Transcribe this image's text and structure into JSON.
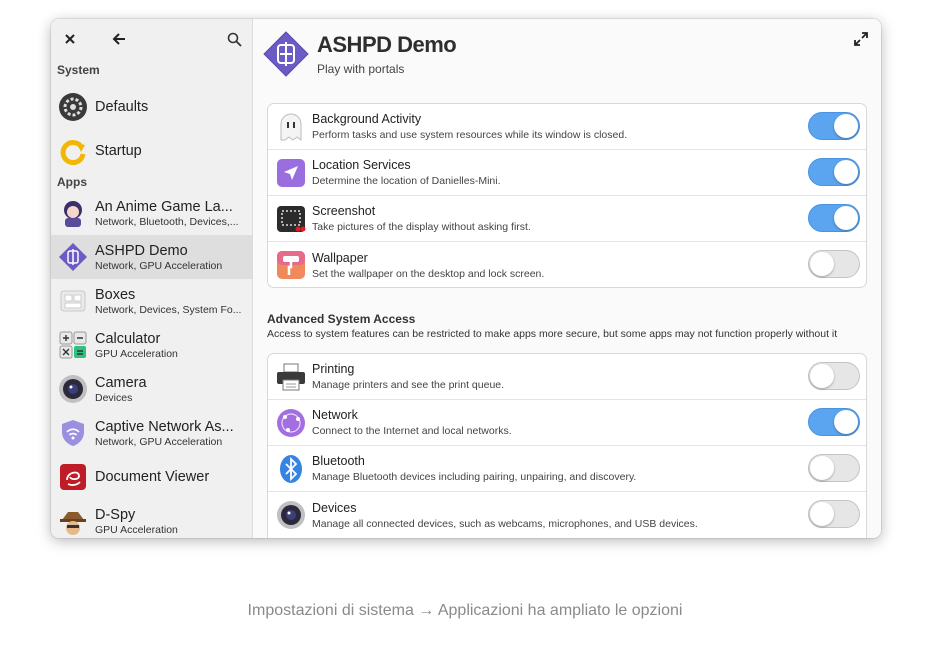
{
  "sidebar": {
    "section_system": "System",
    "system_items": [
      {
        "title": "Defaults",
        "icon": "settings-gear-icon"
      },
      {
        "title": "Startup",
        "icon": "startup-arrow-icon"
      }
    ],
    "section_apps": "Apps",
    "app_items": [
      {
        "title": "An Anime Game La...",
        "sub": "Network, Bluetooth, Devices,..."
      },
      {
        "title": "ASHPD Demo",
        "sub": "Network, GPU Acceleration"
      },
      {
        "title": "Boxes",
        "sub": "Network, Devices, System Fo..."
      },
      {
        "title": "Calculator",
        "sub": "GPU Acceleration"
      },
      {
        "title": "Camera",
        "sub": "Devices"
      },
      {
        "title": "Captive Network As...",
        "sub": "Network, GPU Acceleration"
      },
      {
        "title": "Document Viewer",
        "sub": ""
      },
      {
        "title": "D-Spy",
        "sub": "GPU Acceleration"
      }
    ]
  },
  "main": {
    "app_title": "ASHPD Demo",
    "app_subtitle": "Play with portals",
    "permissions": [
      {
        "title": "Background Activity",
        "sub": "Perform tasks and use system resources while its window is closed.",
        "enabled": true
      },
      {
        "title": "Location Services",
        "sub": "Determine the location of Danielles-Mini.",
        "enabled": true
      },
      {
        "title": "Screenshot",
        "sub": "Take pictures of the display without asking first.",
        "enabled": true
      },
      {
        "title": "Wallpaper",
        "sub": "Set the wallpaper on the desktop and lock screen.",
        "enabled": false
      }
    ],
    "advanced_title": "Advanced System Access",
    "advanced_desc": "Access to system features can be restricted to make apps more secure, but some apps may not function properly without it",
    "advanced": [
      {
        "title": "Printing",
        "sub": "Manage printers and see the print queue.",
        "enabled": false
      },
      {
        "title": "Network",
        "sub": "Connect to the Internet and local networks.",
        "enabled": true
      },
      {
        "title": "Bluetooth",
        "sub": "Manage Bluetooth devices including pairing, unpairing, and discovery.",
        "enabled": false
      },
      {
        "title": "Devices",
        "sub": "Manage all connected devices, such as webcams, microphones, and USB devices.",
        "enabled": false
      }
    ]
  },
  "caption": "Impostazioni di sistema → Applicazioni ha ampliato le opzioni",
  "colors": {
    "accent": "#5aa4f0",
    "toggle_off": "#e6e6e6",
    "sidebar_bg": "#f0f0f0",
    "selected_bg": "#dedede"
  }
}
